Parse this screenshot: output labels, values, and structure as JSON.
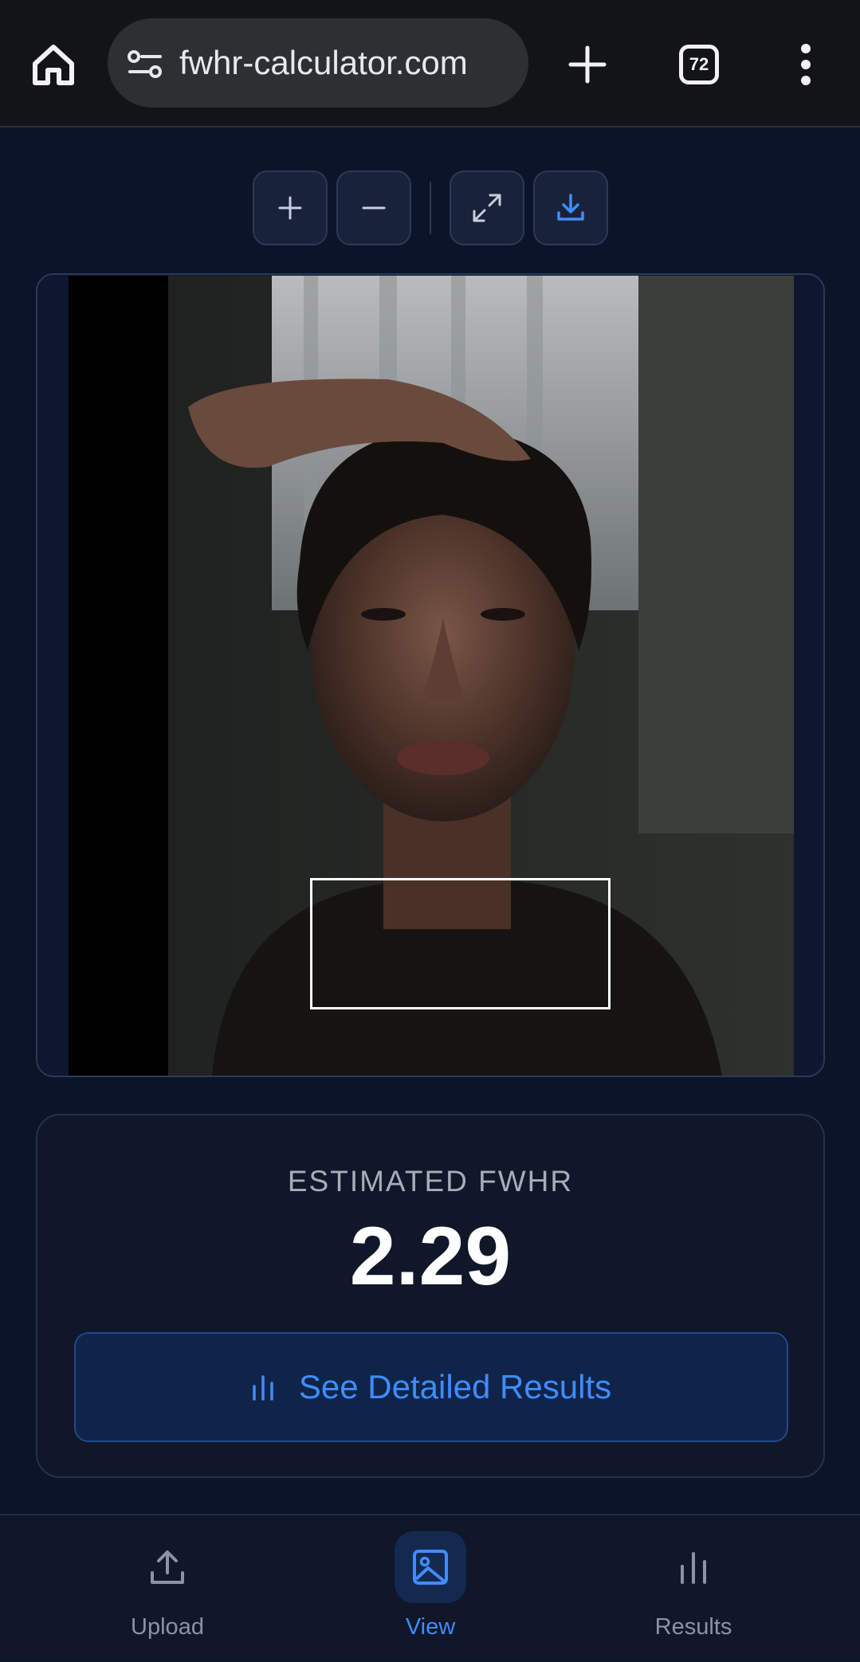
{
  "browser": {
    "url": "fwhr-calculator.com",
    "tab_count": "72"
  },
  "toolbar": {
    "zoom_in": "zoom-in",
    "zoom_out": "zoom-out",
    "fullscreen": "fullscreen",
    "download": "download"
  },
  "result": {
    "label": "ESTIMATED FWHR",
    "value": "2.29",
    "details_button": "See Detailed Results"
  },
  "bottom_nav": {
    "items": [
      {
        "label": "Upload",
        "icon": "upload-icon",
        "active": false
      },
      {
        "label": "View",
        "icon": "image-icon",
        "active": true
      },
      {
        "label": "Results",
        "icon": "bar-chart-icon",
        "active": false
      }
    ]
  },
  "colors": {
    "background": "#0b1428",
    "accent": "#3f8cff",
    "card": "#0f1729",
    "border": "#2b3a58"
  }
}
